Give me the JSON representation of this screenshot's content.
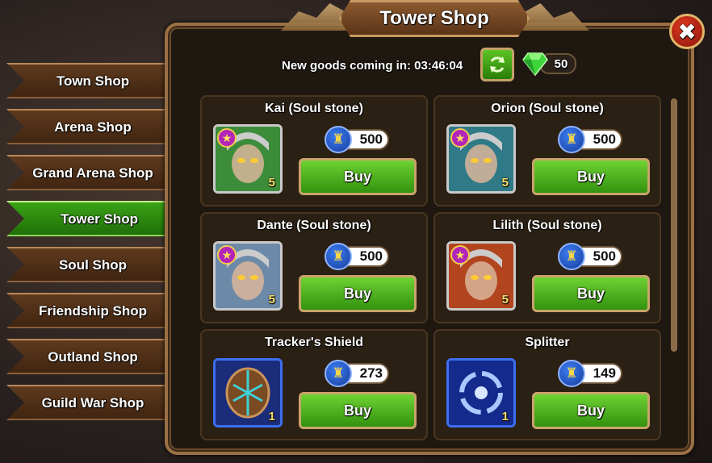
{
  "window": {
    "title": "Tower Shop",
    "close_icon": "✖"
  },
  "tabs": [
    {
      "label": "Town Shop",
      "active": false
    },
    {
      "label": "Arena Shop",
      "active": false
    },
    {
      "label": "Grand Arena Shop",
      "active": false
    },
    {
      "label": "Tower Shop",
      "active": true
    },
    {
      "label": "Soul Shop",
      "active": false
    },
    {
      "label": "Friendship Shop",
      "active": false
    },
    {
      "label": "Outland Shop",
      "active": false
    },
    {
      "label": "Guild War Shop",
      "active": false
    }
  ],
  "header": {
    "timer_label": "New goods coming in:",
    "timer_value": "03:46:04",
    "gems": "50"
  },
  "items": [
    {
      "name": "Kai (Soul stone)",
      "price": "500",
      "qty": "5",
      "buy": "Buy",
      "kind": "hero",
      "color": "#3c8c3a"
    },
    {
      "name": "Orion (Soul stone)",
      "price": "500",
      "qty": "5",
      "buy": "Buy",
      "kind": "hero",
      "color": "#2f7a86"
    },
    {
      "name": "Dante (Soul stone)",
      "price": "500",
      "qty": "5",
      "buy": "Buy",
      "kind": "hero",
      "color": "#6c8aa8"
    },
    {
      "name": "Lilith (Soul stone)",
      "price": "500",
      "qty": "5",
      "buy": "Buy",
      "kind": "hero",
      "color": "#b2441e"
    },
    {
      "name": "Tracker's Shield",
      "price": "273",
      "qty": "1",
      "buy": "Buy",
      "kind": "item",
      "color": "#8a5a2e"
    },
    {
      "name": "Splitter",
      "price": "149",
      "qty": "1",
      "buy": "Buy",
      "kind": "item",
      "color": "#2a3f9c"
    }
  ],
  "colors": {
    "accent_green": "#3aa216",
    "frame_gold": "#9b7044",
    "coin_blue": "#3c7df2"
  }
}
